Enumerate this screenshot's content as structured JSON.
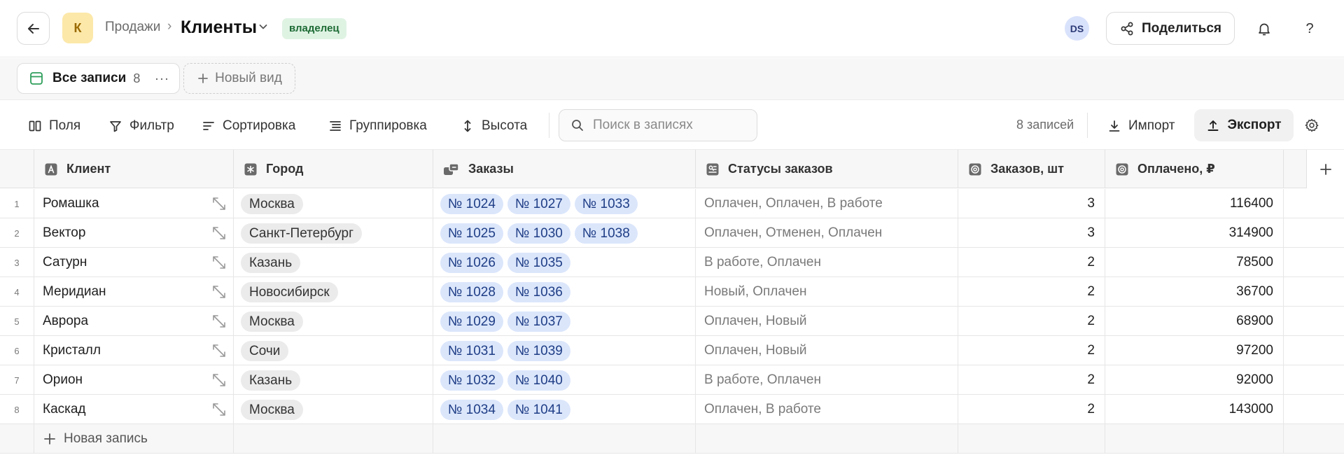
{
  "header": {
    "workspace_initial": "К",
    "breadcrumb_parent": "Продажи",
    "breadcrumb_separator": "›",
    "table_title": "Клиенты",
    "role_badge": "владелец",
    "avatar_initials": "DS",
    "share_label": "Поделиться",
    "help_label": "?"
  },
  "views": {
    "active_view": {
      "label": "Все записи",
      "count": "8",
      "more": "···"
    },
    "new_view_label": "Новый вид"
  },
  "toolbar": {
    "fields_label": "Поля",
    "filter_label": "Фильтр",
    "sort_label": "Сортировка",
    "group_label": "Группировка",
    "height_label": "Высота",
    "search_placeholder": "Поиск в записях",
    "record_count": "8 записей",
    "import_label": "Импорт",
    "export_label": "Экспорт"
  },
  "columns": [
    {
      "label": "Клиент",
      "icon": "text-field-icon"
    },
    {
      "label": "Город",
      "icon": "single-select-icon"
    },
    {
      "label": "Заказы",
      "icon": "linked-records-icon"
    },
    {
      "label": "Статусы заказов",
      "icon": "lookup-icon"
    },
    {
      "label": "Заказов, шт",
      "icon": "rollup-icon"
    },
    {
      "label": "Оплачено, ₽",
      "icon": "rollup-icon"
    }
  ],
  "rows": [
    {
      "num": "1",
      "client": "Ромашка",
      "city": "Москва",
      "orders": [
        "№ 1024",
        "№ 1027",
        "№ 1033"
      ],
      "statuses": "Оплачен, Оплачен, В работе",
      "count": "3",
      "paid": "116400"
    },
    {
      "num": "2",
      "client": "Вектор",
      "city": "Санкт-Петербург",
      "orders": [
        "№ 1025",
        "№ 1030",
        "№ 1038"
      ],
      "statuses": "Оплачен, Отменен, Оплачен",
      "count": "3",
      "paid": "314900"
    },
    {
      "num": "3",
      "client": "Сатурн",
      "city": "Казань",
      "orders": [
        "№ 1026",
        "№ 1035"
      ],
      "statuses": "В работе, Оплачен",
      "count": "2",
      "paid": "78500"
    },
    {
      "num": "4",
      "client": "Меридиан",
      "city": "Новосибирск",
      "orders": [
        "№ 1028",
        "№ 1036"
      ],
      "statuses": "Новый, Оплачен",
      "count": "2",
      "paid": "36700"
    },
    {
      "num": "5",
      "client": "Аврора",
      "city": "Москва",
      "orders": [
        "№ 1029",
        "№ 1037"
      ],
      "statuses": "Оплачен, Новый",
      "count": "2",
      "paid": "68900"
    },
    {
      "num": "6",
      "client": "Кристалл",
      "city": "Сочи",
      "orders": [
        "№ 1031",
        "№ 1039"
      ],
      "statuses": "Оплачен, Новый",
      "count": "2",
      "paid": "97200"
    },
    {
      "num": "7",
      "client": "Орион",
      "city": "Казань",
      "orders": [
        "№ 1032",
        "№ 1040"
      ],
      "statuses": "В работе, Оплачен",
      "count": "2",
      "paid": "92000"
    },
    {
      "num": "8",
      "client": "Каскад",
      "city": "Москва",
      "orders": [
        "№ 1034",
        "№ 1041"
      ],
      "statuses": "Оплачен, В работе",
      "count": "2",
      "paid": "143000"
    }
  ],
  "new_record_label": "Новая запись",
  "colors": {
    "accent_green": "#2e9e5b",
    "order_chip_bg": "#dbe6fb",
    "order_chip_text": "#1f3e86",
    "city_chip_bg": "#ebebeb",
    "role_badge_bg": "#dff3e3",
    "workspace_badge_bg": "#fce8a9"
  }
}
